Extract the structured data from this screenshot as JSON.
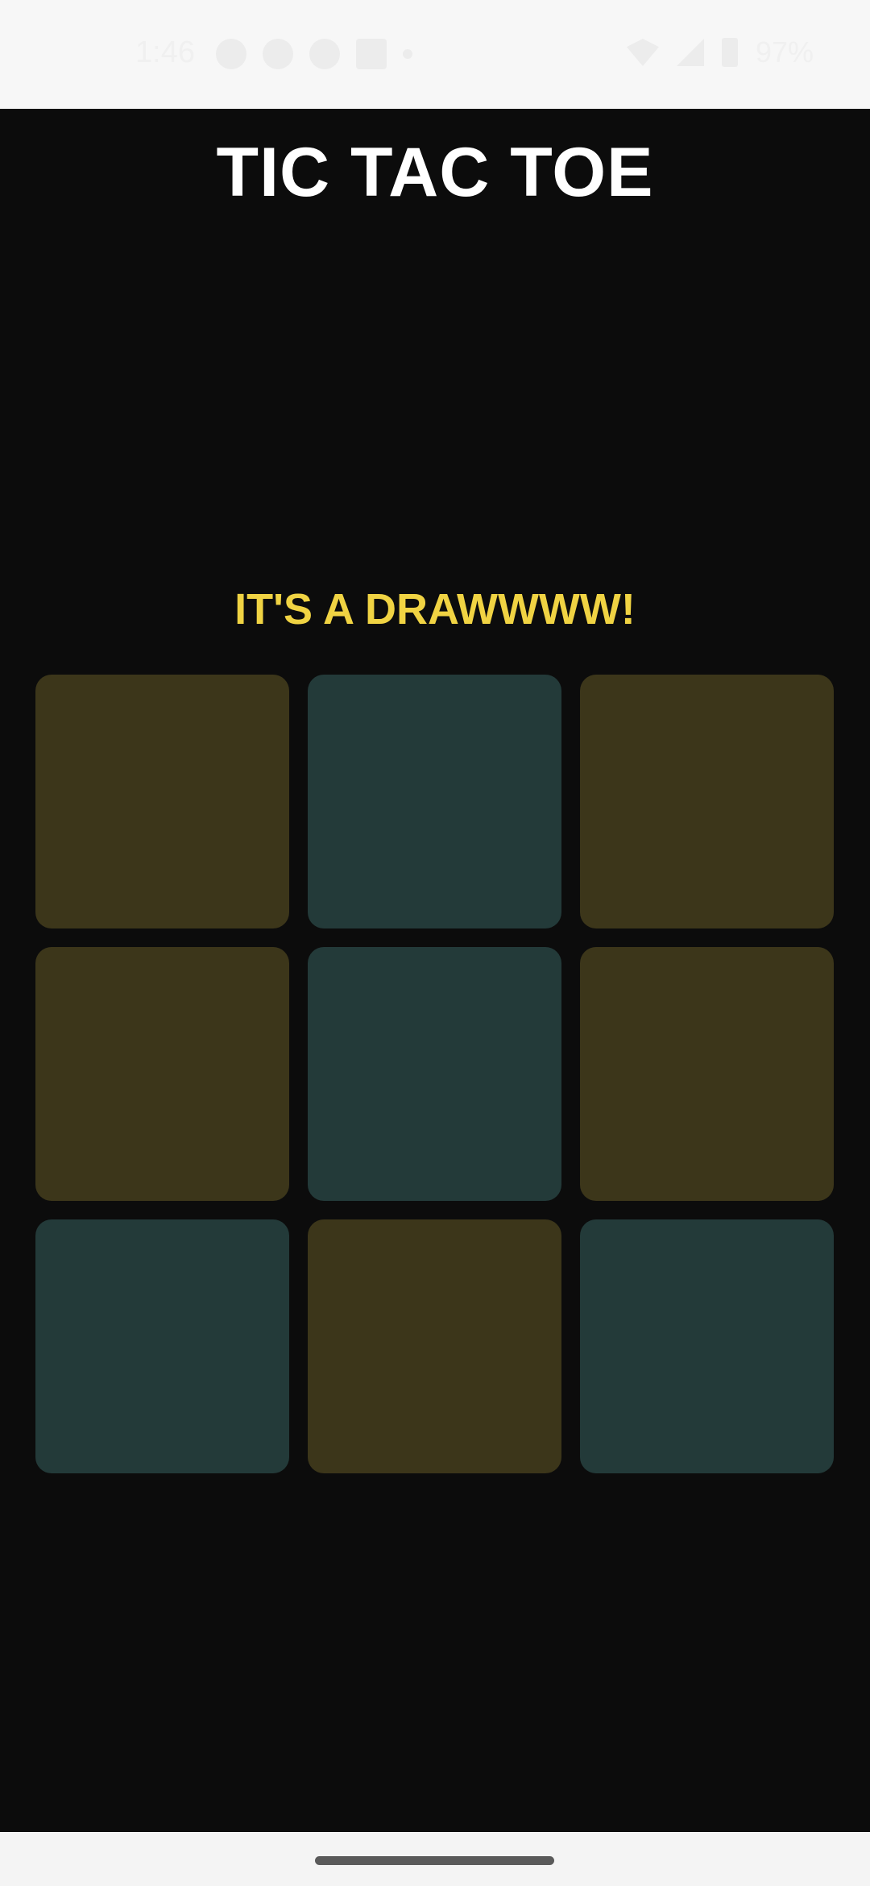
{
  "status_bar": {
    "time": "1:46",
    "notification_icons": [
      "messenger-icon",
      "dot-icon",
      "circle-icon",
      "linkedin-icon",
      "dot-icon"
    ],
    "battery_percent": "97%"
  },
  "app": {
    "title": "TIC TAC TOE",
    "result": "IT'S A DRAWWWW!"
  },
  "board": {
    "cells": [
      "x",
      "o",
      "x",
      "x",
      "o",
      "x",
      "o",
      "x",
      "o"
    ],
    "colors": {
      "x_cell": "#3c361a",
      "o_cell": "#233a39",
      "result_text": "#f0d343",
      "background": "#0c0c0c"
    }
  }
}
